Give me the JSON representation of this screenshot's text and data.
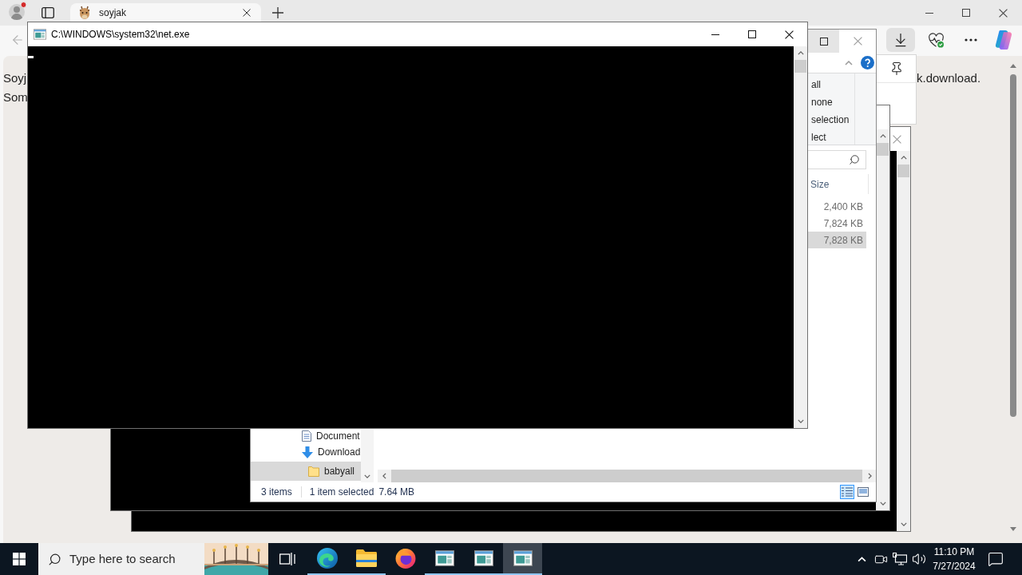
{
  "browser": {
    "tab": {
      "title": "soyjak"
    },
    "toolbar": {
      "downloads_open": true
    },
    "page": {
      "left_lines": [
        "Soyj",
        "Som"
      ],
      "right_line": "k.download."
    }
  },
  "console": {
    "title": "C:\\WINDOWS\\system32\\net.exe"
  },
  "explorer": {
    "ribbon_commands": [
      "all",
      "none",
      "selection",
      "lect"
    ],
    "column": "Size",
    "rows": [
      {
        "size": "2,400 KB",
        "selected": false
      },
      {
        "size": "7,824 KB",
        "selected": false
      },
      {
        "size": "7,828 KB",
        "selected": true
      }
    ],
    "nav_items": [
      {
        "kind": "documents",
        "label": "Document",
        "selected": false
      },
      {
        "kind": "downloads",
        "label": "Download",
        "selected": false
      },
      {
        "kind": "folder",
        "label": "babyall",
        "selected": true
      }
    ],
    "status": {
      "items": "3 items",
      "selection": "1 item selected",
      "size": "7.64 MB"
    },
    "views": [
      {
        "kind": "details",
        "selected": true
      },
      {
        "kind": "large_icons",
        "selected": false
      }
    ]
  },
  "taskbar": {
    "search": {
      "placeholder": "Type here to search"
    },
    "apps": [
      {
        "kind": "edge",
        "running": true,
        "selected": false
      },
      {
        "kind": "explorer",
        "running": true,
        "selected": false
      },
      {
        "kind": "firefox",
        "running": false,
        "selected": false
      },
      {
        "kind": "console",
        "running": true,
        "selected": false
      },
      {
        "kind": "console",
        "running": true,
        "selected": false
      },
      {
        "kind": "console",
        "running": true,
        "selected": true
      }
    ],
    "clock": {
      "time": "11:10 PM",
      "date": "7/27/2024"
    }
  }
}
